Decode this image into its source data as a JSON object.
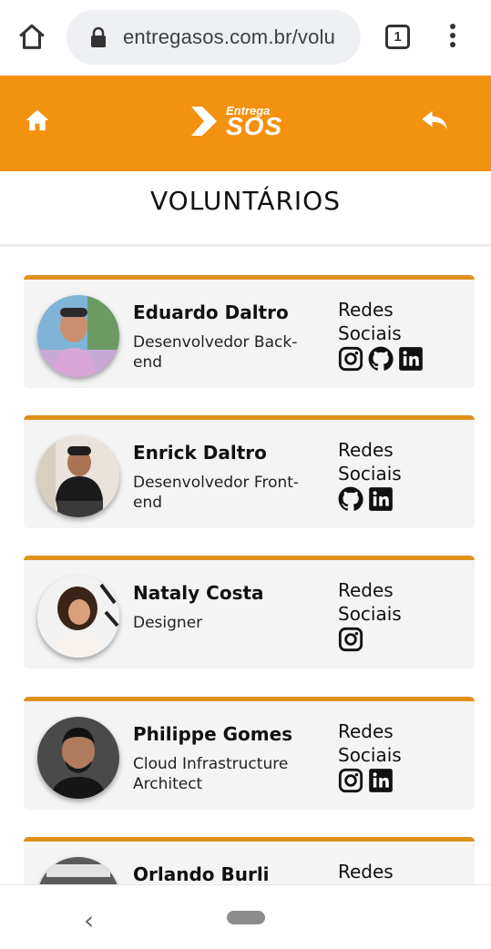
{
  "browser": {
    "url": "entregasos.com.br/volu",
    "tab_count": "1",
    "icons": [
      "home-icon",
      "lock-icon",
      "tabs-icon",
      "more-vert-icon"
    ]
  },
  "header": {
    "logo_small": "Entrega",
    "logo_big": "SOS",
    "bg_color": "#f39110",
    "icons": [
      "home-icon",
      "reply-icon"
    ]
  },
  "page": {
    "title": "VOLUNTÁRIOS"
  },
  "volunteers": [
    {
      "name": "Eduardo Daltro",
      "role": "Desenvolvedor Back-end",
      "social_label": "Redes Sociais",
      "social": [
        "instagram-icon",
        "github-icon",
        "linkedin-icon"
      ]
    },
    {
      "name": "Enrick Daltro",
      "role": "Desenvolvedor Front-end",
      "social_label": "Redes Sociais",
      "social": [
        "github-icon",
        "linkedin-icon"
      ]
    },
    {
      "name": "Nataly Costa",
      "role": "Designer",
      "social_label": "Redes Sociais",
      "social": [
        "instagram-icon"
      ]
    },
    {
      "name": "Philippe Gomes",
      "role": "Cloud Infrastructure Architect",
      "social_label": "Redes Sociais",
      "social": [
        "instagram-icon",
        "linkedin-icon"
      ]
    },
    {
      "name": "Orlando Burli",
      "role": "",
      "social_label": "Redes",
      "social": []
    }
  ],
  "colors": {
    "accent": "#f39110",
    "card_border": "#e0901b",
    "card_bg": "#f4f4f4"
  },
  "system_nav": {
    "icons": [
      "back-chevron-icon",
      "home-pill-icon"
    ]
  }
}
